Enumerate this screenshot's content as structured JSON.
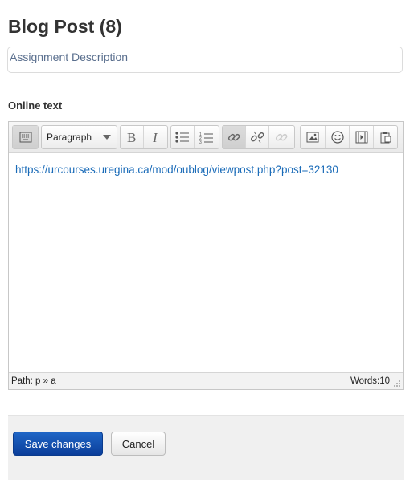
{
  "page": {
    "title": "Blog Post (8)",
    "description_placeholder": "Assignment Description"
  },
  "online_text": {
    "label": "Online text",
    "toolbar": {
      "format_select": "Paragraph",
      "icons": [
        "toolbar-toggle-icon",
        "bold-icon",
        "italic-icon",
        "bulleted-list-icon",
        "numbered-list-icon",
        "link-icon",
        "unlink-icon",
        "anchor-icon",
        "image-icon",
        "emoticon-icon",
        "media-icon",
        "paste-icon"
      ]
    },
    "content_link": "https://urcourses.uregina.ca/mod/oublog/viewpost.php?post=32130",
    "status": {
      "path": "Path: p » a",
      "words": "Words:10"
    }
  },
  "actions": {
    "save_label": "Save changes",
    "cancel_label": "Cancel"
  },
  "colors": {
    "link": "#1a6bb8",
    "primary_button": "#0b3e9a"
  }
}
